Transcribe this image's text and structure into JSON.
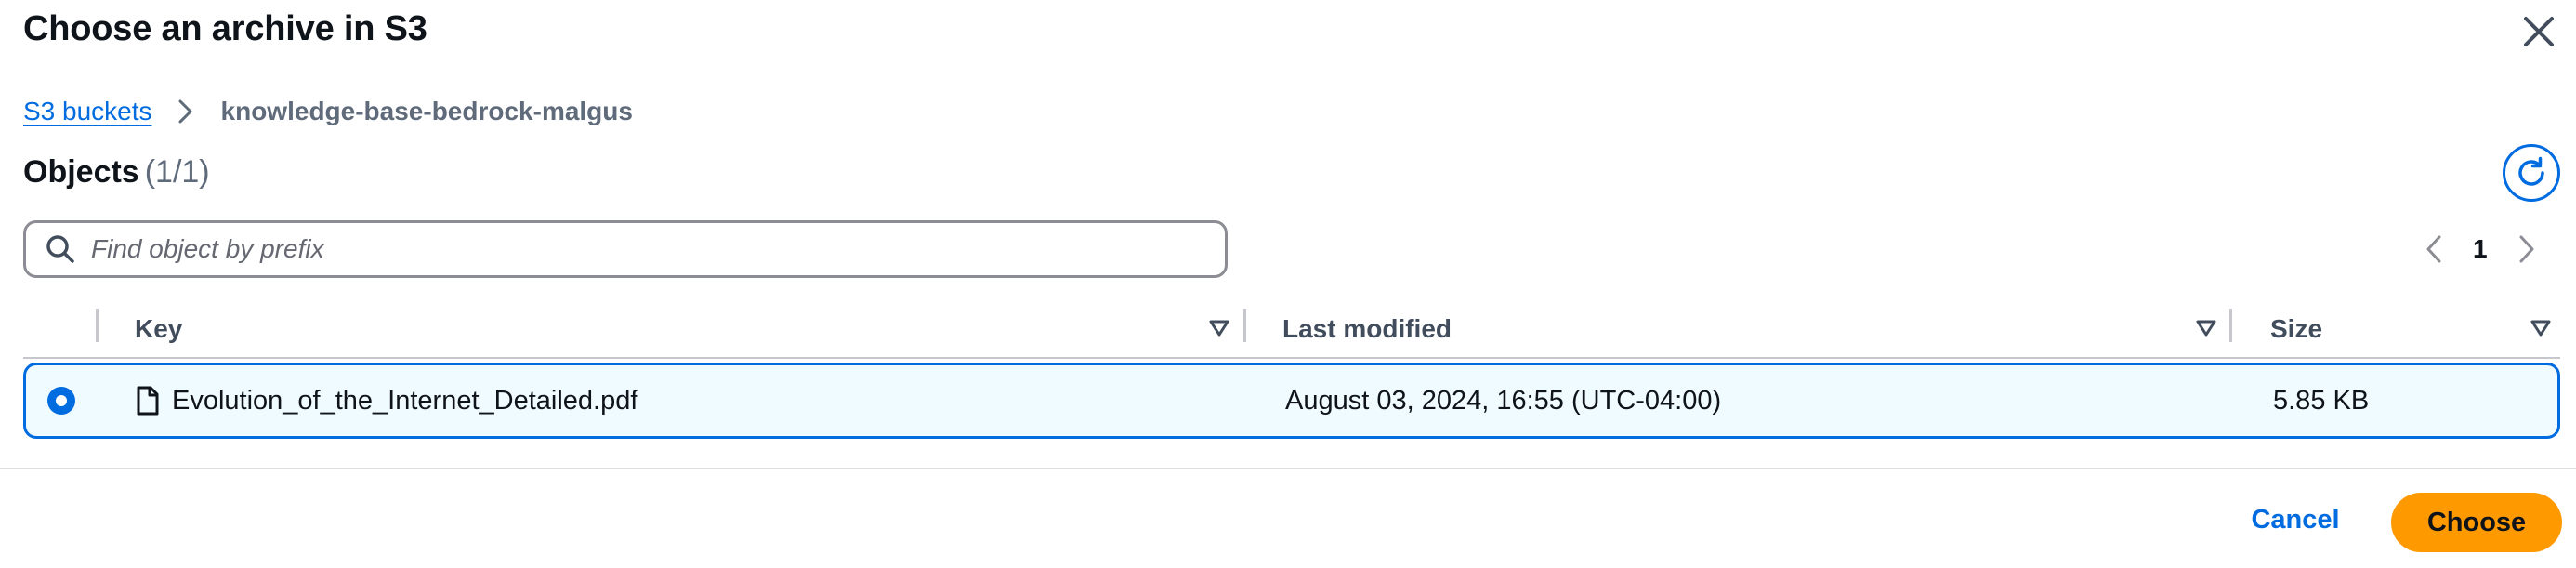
{
  "modal": {
    "title": "Choose an archive in S3"
  },
  "breadcrumb": {
    "root_label": "S3 buckets",
    "current_label": "knowledge-base-bedrock-malgus"
  },
  "objects": {
    "heading": "Objects",
    "count": "(1/1)"
  },
  "search": {
    "placeholder": "Find object by prefix",
    "value": ""
  },
  "pagination": {
    "current_page": "1"
  },
  "table": {
    "columns": [
      "Key",
      "Last modified",
      "Size"
    ],
    "rows": [
      {
        "selected": true,
        "key": "Evolution_of_the_Internet_Detailed.pdf",
        "last_modified": "August 03, 2024, 16:55 (UTC-04:00)",
        "size": "5.85 KB"
      }
    ]
  },
  "footer": {
    "cancel_label": "Cancel",
    "choose_label": "Choose"
  },
  "icons": {
    "close": "close-icon",
    "breadcrumb_separator": "chevron-right-icon",
    "refresh": "refresh-icon",
    "search": "search-icon",
    "prev_page": "chevron-left-icon",
    "next_page": "chevron-right-icon",
    "sort": "caret-down-icon",
    "file": "file-icon"
  },
  "colors": {
    "link": "#006ce0",
    "primary_button": "#ff9900",
    "selected_row_bg": "#f0fbff",
    "muted_text": "#5f6b7a"
  }
}
